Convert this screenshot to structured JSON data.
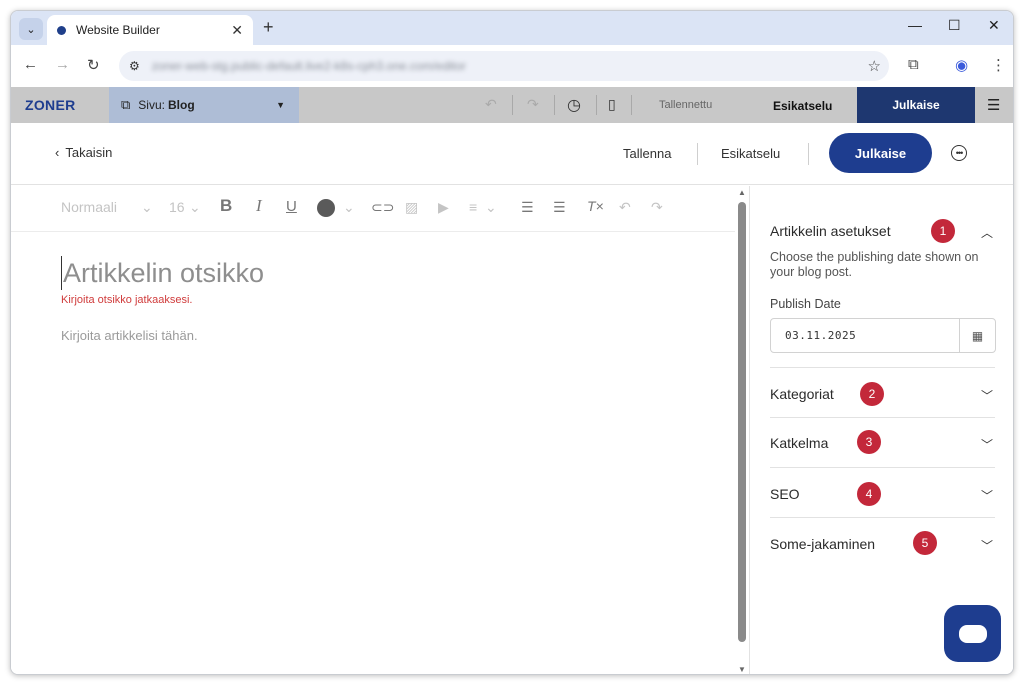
{
  "browser": {
    "tab_title": "Website Builder",
    "tab_close": "✕",
    "new_tab": "+",
    "tab_menu": "⌄",
    "url": "zoner-web-stg.public-default.live2-k8s-cph3.one.com/editor",
    "window_controls": {
      "minimize": "—",
      "maximize": "☐",
      "close": "✕"
    },
    "nav": {
      "back": "←",
      "forward": "→",
      "reload": "↻"
    }
  },
  "appbar": {
    "logo": "ZONER",
    "page_prefix": "Sivu: ",
    "page_name": "Blog",
    "saved_label": "Tallennettu",
    "preview_label": "Esikatselu",
    "publish_label": "Julkaise"
  },
  "editor_header": {
    "back_label": "Takaisin",
    "save_label": "Tallenna",
    "preview_label": "Esikatselu",
    "publish_label": "Julkaise"
  },
  "toolbar": {
    "style_label": "Normaali",
    "font_size": "16"
  },
  "content": {
    "title_placeholder": "Artikkelin otsikko",
    "title_error": "Kirjoita otsikko jatkaaksesi.",
    "body_placeholder": "Kirjoita artikkelisi tähän."
  },
  "sidebar": {
    "article_settings": {
      "title": "Artikkelin asetukset",
      "badge": "1",
      "description": "Choose the publishing date shown on your blog post.",
      "publish_date_label": "Publish Date",
      "publish_date_value": "03.11.2025"
    },
    "sections": [
      {
        "title": "Kategoriat",
        "badge": "2"
      },
      {
        "title": "Katkelma",
        "badge": "3"
      },
      {
        "title": "SEO",
        "badge": "4"
      },
      {
        "title": "Some-jakaminen",
        "badge": "5"
      }
    ]
  },
  "colors": {
    "brand_blue": "#1e3d8f",
    "badge_red": "#c3283a",
    "error_red": "#d03c3c"
  }
}
